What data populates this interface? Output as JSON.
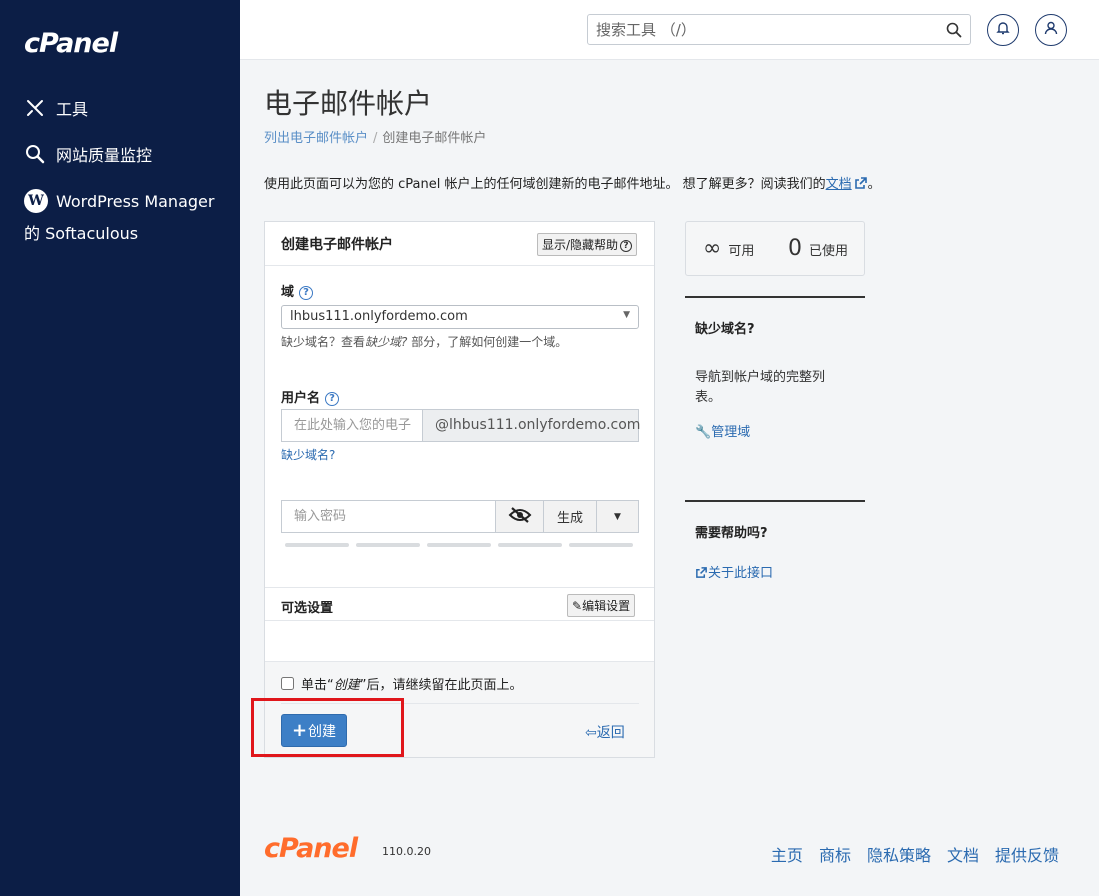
{
  "sidebar": {
    "logo": "cPanel",
    "items": [
      {
        "label": "工具",
        "icon": "tools-icon"
      },
      {
        "label": "网站质量监控",
        "icon": "magnifier-icon"
      },
      {
        "label": "WordPress Manager 的 Softaculous",
        "icon": "wordpress-icon"
      }
    ]
  },
  "topbar": {
    "search_placeholder": "搜索工具 （/）"
  },
  "page": {
    "title": "电子邮件帐户",
    "breadcrumb": [
      "列出电子邮件帐户",
      "创建电子邮件帐户"
    ],
    "description": "使用此页面可以为您的 cPanel 帐户上的任何域创建新的电子邮件地址。 想了解更多？阅读我们的",
    "description_link": "文档",
    "description_end": "。"
  },
  "form": {
    "title": "创建电子邮件帐户",
    "toggle_help": "显示/隐藏帮助",
    "domain_label": "域",
    "domain_value": "lhbus111.onlyfordemo.com",
    "domain_hint_1": "缺少域名？查看",
    "domain_hint_italic": "缺少域?",
    "domain_hint_2": "部分，了解如何创建一个域。",
    "username_label": "用户名",
    "username_placeholder": "在此处输入您的电子",
    "username_domain": "@lhbus111.onlyfordemo.com",
    "missing_domain_link": "缺少域名?",
    "password_placeholder": "输入密码",
    "generate_label": "生成",
    "optional_title": "可选设置",
    "edit_settings": "编辑设置",
    "stay_1": "单击“",
    "stay_italic": "创建",
    "stay_2": "”后，请继续留在此页面上。",
    "create_label": "创建",
    "back_label": "返回"
  },
  "stats": {
    "available_value": "∞",
    "available_label": "可用",
    "used_value": "0",
    "used_label": "已使用"
  },
  "side": {
    "missing_title": "缺少域名?",
    "missing_text": "导航到帐户域的完整列表。",
    "manage_link": "管理域",
    "help_title": "需要帮助吗?",
    "about_link": "关于此接口"
  },
  "footer": {
    "logo": "cPanel",
    "version": "110.0.20",
    "links": [
      "主页",
      "商标",
      "隐私策略",
      "文档",
      "提供反馈"
    ]
  }
}
